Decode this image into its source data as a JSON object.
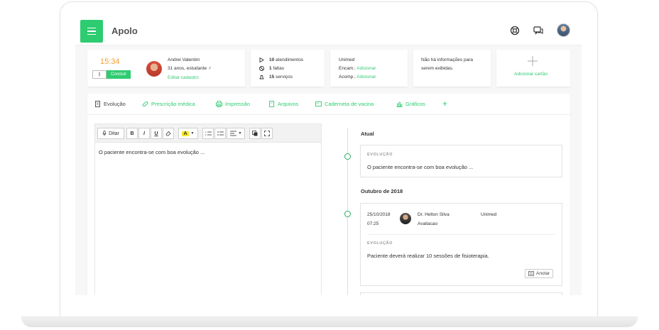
{
  "app": {
    "title": "Apolo"
  },
  "header_icons": [
    "support-icon",
    "chat-icon",
    "user-avatar"
  ],
  "session": {
    "timer": "15:34",
    "pause_label": "||",
    "conclude_label": "Concluir"
  },
  "patient": {
    "name": "Andrei Valentim",
    "details": "31 anos, estudante ♂",
    "edit_link": "Editar cadastro"
  },
  "stats": {
    "attendances_count": "10",
    "attendances_label": "atendimentos",
    "absences_count": "1",
    "absences_label": "faltas",
    "services_count": "15",
    "services_label": "serviços"
  },
  "insurance": {
    "name": "Unimed",
    "encam_label": "Encam.:",
    "encam_value": "Adicionar",
    "acomp_label": "Acomp.:",
    "acomp_value": "Adicionar"
  },
  "info_card": {
    "text_line1": "Não há informações para",
    "text_line2": "serem exibidas."
  },
  "add_card": {
    "label": "Adicionar cartão"
  },
  "tabs": [
    {
      "label": "Evolução",
      "icon": "document-icon"
    },
    {
      "label": "Prescrição médica",
      "icon": "pill-icon"
    },
    {
      "label": "Impressão",
      "icon": "printer-icon"
    },
    {
      "label": "Arquivos",
      "icon": "files-icon"
    },
    {
      "label": "Caderneta de vacina",
      "icon": "vaccine-card-icon"
    },
    {
      "label": "Gráficos",
      "icon": "chart-icon"
    },
    {
      "label": "+",
      "icon": "plus-icon"
    }
  ],
  "toolbar": {
    "dictate_label": "Ditar",
    "bold": "B",
    "italic": "I",
    "underline": "U",
    "highlight": "A"
  },
  "editor": {
    "content": "O paciente encontra-se com boa evolução ..."
  },
  "timeline": {
    "current_heading": "Atual",
    "current_entry": {
      "type_label": "EVOLUÇÃO",
      "text": "O paciente encontra-se com boa evolução ..."
    },
    "month_heading": "Outubro de 2018",
    "entry": {
      "date": "25/10/2018",
      "time": "07:25",
      "doctor": "Dr. Helton Silva",
      "category": "Avaliacao",
      "insurance": "Unimed",
      "type_label": "EVOLUÇÃO",
      "text": "Paciente deverá realizar 10 sessões de fisioterapia.",
      "annotate_label": "Anotar"
    }
  },
  "colors": {
    "accent": "#2ecc71",
    "timer": "#f0a030"
  }
}
